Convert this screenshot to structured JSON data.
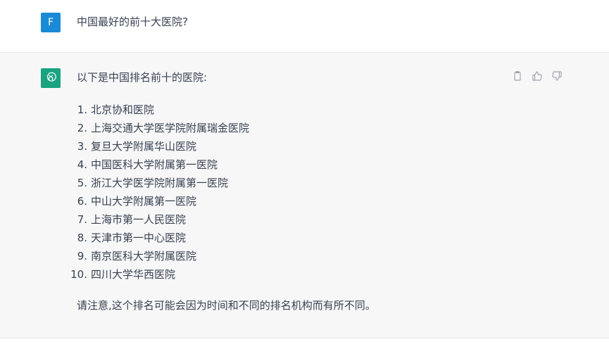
{
  "user": {
    "avatar_initial": "F",
    "message": "中国最好的前十大医院?"
  },
  "assistant": {
    "intro": "以下是中国排名前十的医院:",
    "list": [
      {
        "num": "1.",
        "text": "北京协和医院"
      },
      {
        "num": "2.",
        "text": "上海交通大学医学院附属瑞金医院"
      },
      {
        "num": "3.",
        "text": "复旦大学附属华山医院"
      },
      {
        "num": "4.",
        "text": "中国医科大学附属第一医院"
      },
      {
        "num": "5.",
        "text": "浙江大学医学院附属第一医院"
      },
      {
        "num": "6.",
        "text": "中山大学附属第一医院"
      },
      {
        "num": "7.",
        "text": "上海市第一人民医院"
      },
      {
        "num": "8.",
        "text": "天津市第一中心医院"
      },
      {
        "num": "9.",
        "text": "南京医科大学附属医院"
      },
      {
        "num": "10.",
        "text": "四川大学华西医院"
      }
    ],
    "note": "请注意,这个排名可能会因为时间和不同的排名机构而有所不同。"
  },
  "icons": {
    "bot_avatar": "openai-logo-icon",
    "copy": "clipboard-icon",
    "like": "thumbs-up-icon",
    "dislike": "thumbs-down-icon"
  },
  "colors": {
    "user_avatar": "#1a8ad6",
    "bot_avatar": "#19a37f",
    "assistant_bg": "#f7f7f8",
    "text": "#374151",
    "icon": "#8e8ea0"
  }
}
